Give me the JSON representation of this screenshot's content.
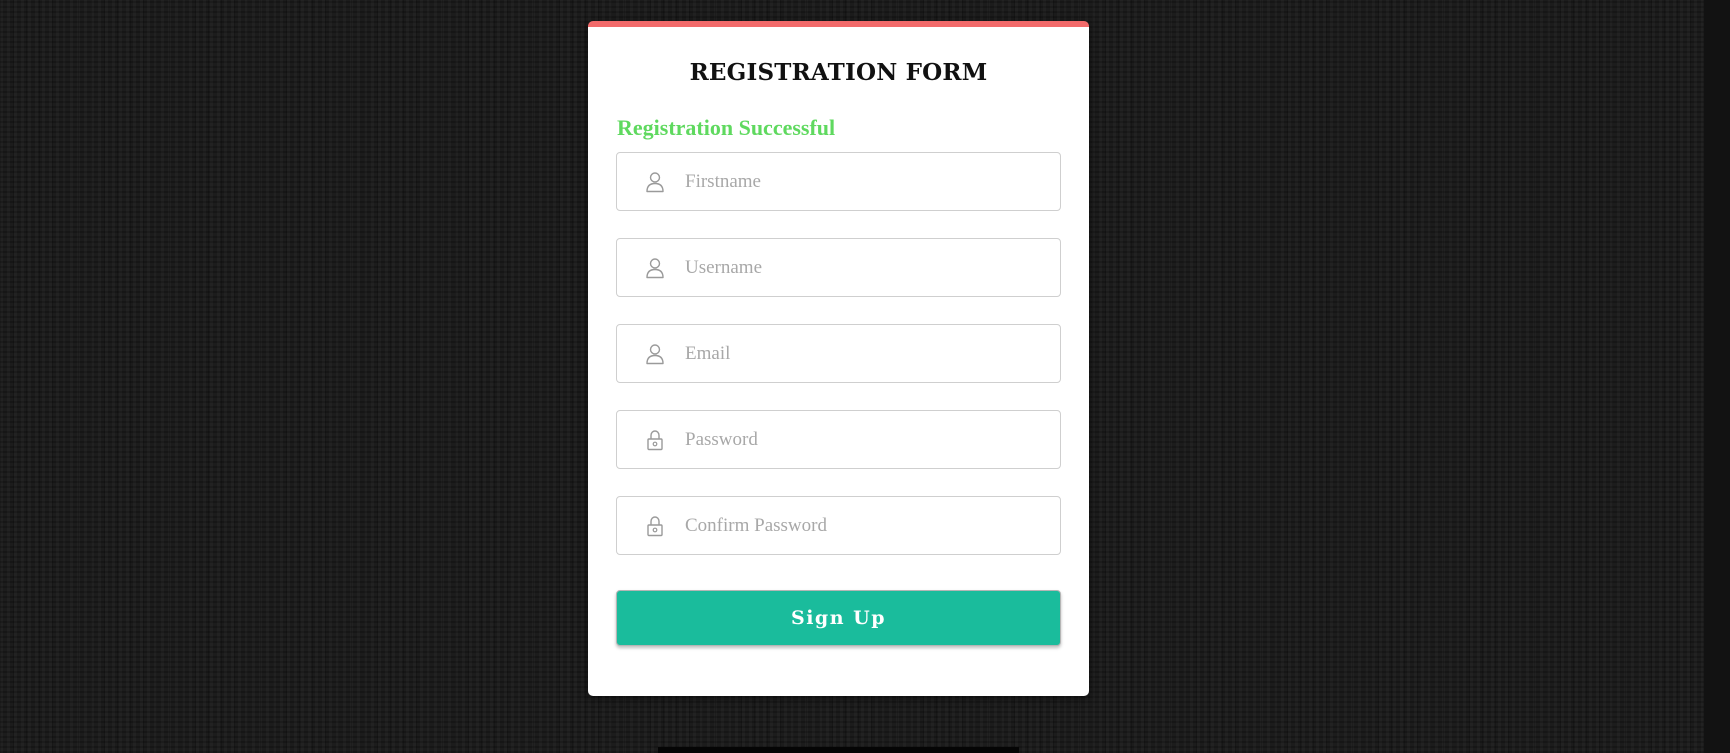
{
  "form": {
    "title": "REGISTRATION FORM",
    "success_message": "Registration Successful",
    "fields": [
      {
        "placeholder": "Firstname",
        "value": "",
        "icon": "user-icon"
      },
      {
        "placeholder": "Username",
        "value": "",
        "icon": "user-icon"
      },
      {
        "placeholder": "Email",
        "value": "",
        "icon": "user-icon"
      },
      {
        "placeholder": "Password",
        "value": "",
        "icon": "lock-icon"
      },
      {
        "placeholder": "Confirm Password",
        "value": "",
        "icon": "lock-icon"
      }
    ],
    "submit_label": "Sign Up"
  },
  "colors": {
    "accent_top_border": "#f26a6a",
    "success_text": "#5fd95f",
    "button_background": "#1abc9c",
    "background": "#1c1c1c"
  }
}
